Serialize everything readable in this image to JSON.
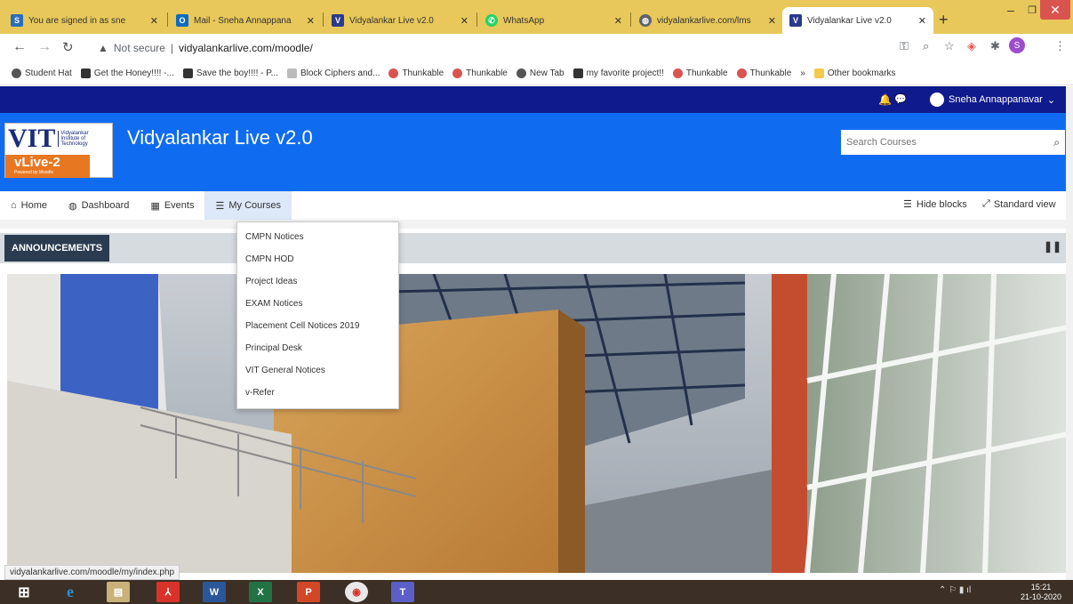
{
  "tabs": [
    {
      "title": "You are signed in as sne",
      "icon": "s-favicon",
      "color": "#2a6ebb"
    },
    {
      "title": "Mail - Sneha Annappana",
      "icon": "outlook-favicon",
      "color": "#0f6cbd"
    },
    {
      "title": "Vidyalankar Live v2.0",
      "icon": "v-favicon",
      "color": "#2b3a8c"
    },
    {
      "title": "WhatsApp",
      "icon": "whatsapp-favicon",
      "color": "#25d366"
    },
    {
      "title": "vidyalankarlive.com/lms",
      "icon": "globe-favicon",
      "color": "#5f6368"
    },
    {
      "title": "Vidyalankar Live v2.0",
      "icon": "v-favicon",
      "color": "#2b3a8c"
    }
  ],
  "address": {
    "security": "Not secure",
    "url": "vidyalankarlive.com/moodle/"
  },
  "bookmarks": [
    "Student Hat",
    "Get the Honey!!!! -...",
    "Save the boy!!!! - P...",
    "Block Ciphers and...",
    "Thunkable",
    "Thunkable",
    "New Tab",
    "my favorite project!!",
    "Thunkable",
    "Thunkable",
    "»",
    "Other bookmarks"
  ],
  "header": {
    "user": "Sneha Annappanavar",
    "site_title": "Vidyalankar Live v2.0",
    "search_placeholder": "Search Courses",
    "logo_big": "VIT",
    "logo_small": "Vidyalankar Institute of Technology",
    "logo_sub": "vLive-2",
    "logo_tag": "Powered by Moodle"
  },
  "menu": {
    "home": "Home",
    "dashboard": "Dashboard",
    "events": "Events",
    "my_courses": "My Courses",
    "hide_blocks": "Hide blocks",
    "standard_view": "Standard view"
  },
  "courses": [
    "CMPN Notices",
    "CMPN HOD",
    "Project Ideas",
    "EXAM Notices",
    "Placement Cell Notices 2019",
    "Principal Desk",
    "VIT General Notices",
    "v-Refer"
  ],
  "announcements": "ANNOUNCEMENTS",
  "status_url": "vidyalankarlive.com/moodle/my/index.php",
  "clock": {
    "time": "15:21",
    "date": "21-10-2020"
  }
}
